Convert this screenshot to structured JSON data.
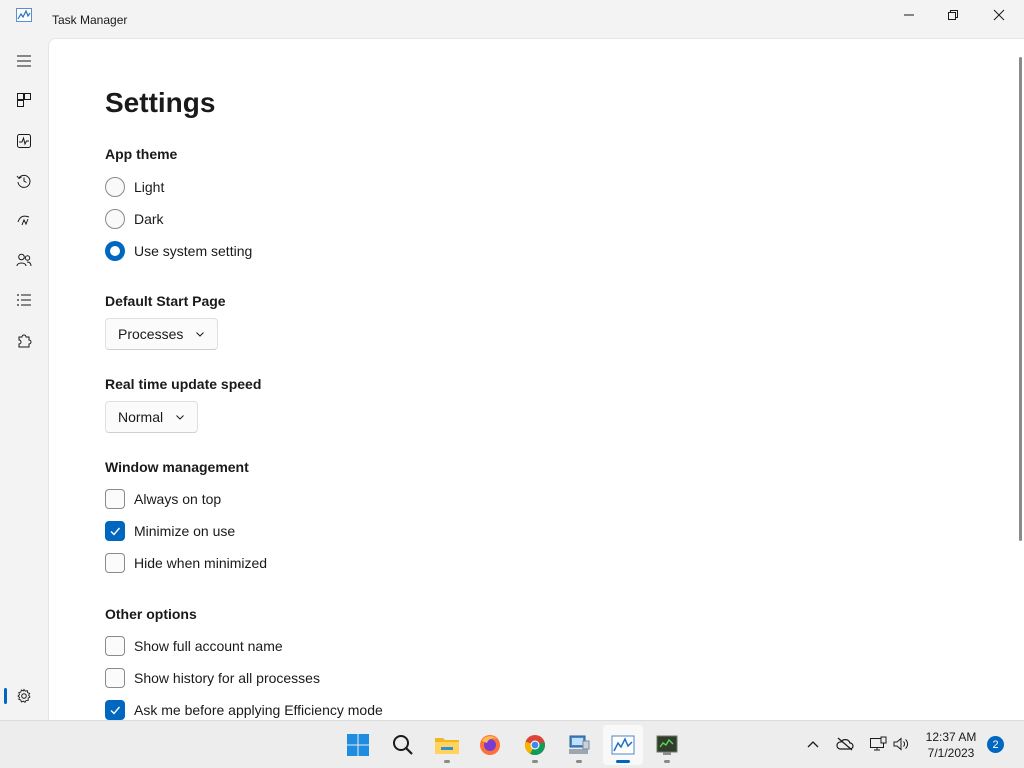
{
  "window": {
    "title": "Task Manager"
  },
  "sidebar": {
    "items": [
      {
        "name": "hamburger"
      },
      {
        "name": "processes"
      },
      {
        "name": "performance"
      },
      {
        "name": "app-history"
      },
      {
        "name": "startup-apps"
      },
      {
        "name": "users"
      },
      {
        "name": "details"
      },
      {
        "name": "services"
      },
      {
        "name": "settings"
      }
    ]
  },
  "settings": {
    "title": "Settings",
    "app_theme": {
      "label": "App theme",
      "options": [
        "Light",
        "Dark",
        "Use system setting"
      ],
      "selected": "Use system setting"
    },
    "start_page": {
      "label": "Default Start Page",
      "value": "Processes"
    },
    "update_speed": {
      "label": "Real time update speed",
      "value": "Normal"
    },
    "window_management": {
      "label": "Window management",
      "options": [
        {
          "label": "Always on top",
          "checked": false
        },
        {
          "label": "Minimize on use",
          "checked": true
        },
        {
          "label": "Hide when minimized",
          "checked": false
        }
      ]
    },
    "other_options": {
      "label": "Other options",
      "options": [
        {
          "label": "Show full account name",
          "checked": false
        },
        {
          "label": "Show history for all processes",
          "checked": false
        },
        {
          "label": "Ask me before applying Efficiency mode",
          "checked": true
        }
      ]
    }
  },
  "taskbar": {
    "apps": [
      "start",
      "search",
      "file-explorer",
      "firefox",
      "chrome",
      "computer",
      "task-manager",
      "terminal"
    ],
    "active_app": "task-manager",
    "clock": {
      "time": "12:37 AM",
      "date": "7/1/2023"
    },
    "notifications": "2"
  },
  "colors": {
    "accent": "#0067c0",
    "background": "#f3f3f3",
    "content": "#ffffff"
  }
}
